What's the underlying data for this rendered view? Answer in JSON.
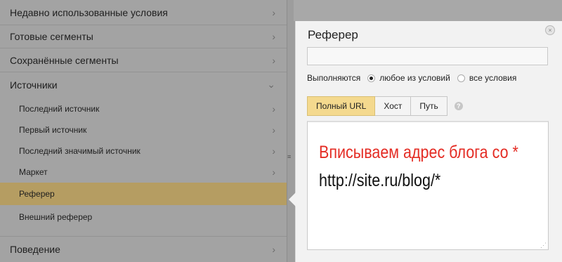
{
  "menu": {
    "items": [
      {
        "label": "Недавно использованные условия",
        "chevron": "›"
      },
      {
        "label": "Готовые сегменты",
        "chevron": "›"
      },
      {
        "label": "Сохранённые сегменты",
        "chevron": "›"
      },
      {
        "label": "Источники",
        "chevron": "⌄"
      },
      {
        "label": "Последний источник",
        "chevron": "›"
      },
      {
        "label": "Первый источник",
        "chevron": "›"
      },
      {
        "label": "Последний значимый источник",
        "chevron": "›"
      },
      {
        "label": "Маркет",
        "chevron": "›"
      },
      {
        "label": "Реферер",
        "chevron": ""
      },
      {
        "label": "Внешний реферер",
        "chevron": ""
      },
      {
        "label": "Поведение",
        "chevron": "›"
      }
    ]
  },
  "popup": {
    "title": "Реферер",
    "close": "×",
    "field_value": "",
    "match_label": "Выполняются",
    "option_any": "любое из условий",
    "option_all": "все условия",
    "tabs": [
      "Полный URL",
      "Хост",
      "Путь"
    ],
    "help": "?",
    "overlay_text": "Вписываем адрес блога со *",
    "url_text": "http://site.ru/blog/*"
  },
  "colors": {
    "accent": "#b59d62",
    "tab_active": "#f4d98e",
    "red_text": "#e42c24"
  }
}
